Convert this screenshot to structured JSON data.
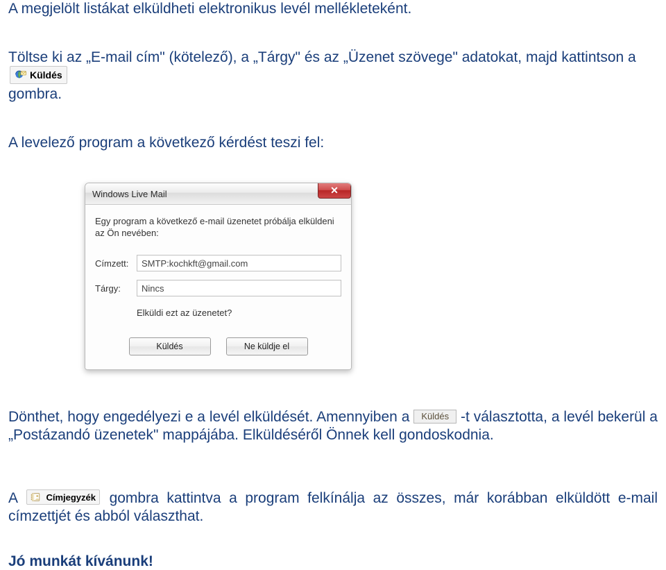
{
  "p1": "A megjelölt listákat elküldheti elektronikus levél mellékleteként.",
  "p2a": "Töltse ki az „E-mail cím\" (kötelező), a „Tárgy\" és az „Üzenet szövege\" adatokat, majd kattintson a",
  "p2b": "gombra.",
  "p3": "A levelező program a következő kérdést teszi fel:",
  "send_btn_label": "Küldés",
  "address_btn_label": "Címjegyzék",
  "dialog": {
    "title": "Windows Live Mail",
    "message": "Egy program a következő e-mail üzenetet próbálja elküldeni az Ön nevében:",
    "to_label": "Címzett:",
    "to_value": "SMTP:kochkft@gmail.com",
    "subject_label": "Tárgy:",
    "subject_value": "Nincs",
    "question": "Elküldi ezt az üzenetet?",
    "send": "Küldés",
    "dont_send": "Ne küldje el"
  },
  "p4a": "Dönthet,  hogy  engedélyezi  e  a  levél   elküldését.  Amennyiben  a ",
  "p4b": " -t  választotta,  a  levél  bekerül  a „Postázandó üzenetek\" mappájába. Elküldéséről Önnek kell gondoskodnia.",
  "kuldes_plain": "Küldés",
  "p5a": "A ",
  "p5b": " gombra kattintva a program felkínálja az összes, már korábban elküldött e-mail címzettjét és abból választhat.",
  "footer": "Jó munkát kívánunk!"
}
